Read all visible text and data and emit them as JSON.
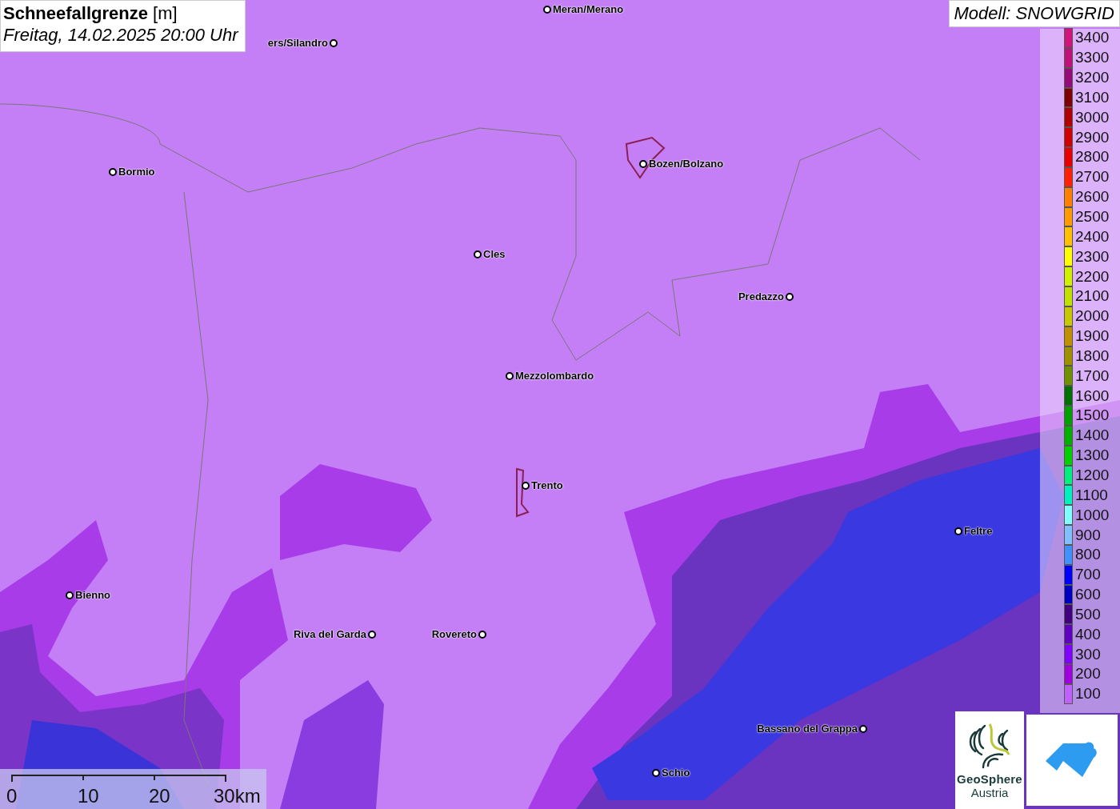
{
  "title": {
    "heading": "**Schneefallgrenze** [m]",
    "datetime": "Freitag, 14.02.2025 20:00 Uhr"
  },
  "model": "Modell: SNOWGRID",
  "cities": [
    {
      "name": "Meran/Merano"
    },
    {
      "name": "ers/Silandro"
    },
    {
      "name": "Bormio"
    },
    {
      "name": "Bozen/Bolzano"
    },
    {
      "name": "Cles"
    },
    {
      "name": "Predazzo"
    },
    {
      "name": "Mezzolombardo"
    },
    {
      "name": "Trento"
    },
    {
      "name": "Feltre"
    },
    {
      "name": "Bienno"
    },
    {
      "name": "Riva del Garda"
    },
    {
      "name": "Rovereto"
    },
    {
      "name": "Bassano del Grappa"
    },
    {
      "name": "Schio"
    }
  ],
  "legend": [
    {
      "label": "3400",
      "color": "#d0147c"
    },
    {
      "label": "3300",
      "color": "#c0107a"
    },
    {
      "label": "3200",
      "color": "#960a7a"
    },
    {
      "label": "3100",
      "color": "#800000"
    },
    {
      "label": "3000",
      "color": "#b00000"
    },
    {
      "label": "2900",
      "color": "#d00000"
    },
    {
      "label": "2800",
      "color": "#e80000"
    },
    {
      "label": "2700",
      "color": "#ff2000"
    },
    {
      "label": "2600",
      "color": "#ff8000"
    },
    {
      "label": "2500",
      "color": "#ff9a00"
    },
    {
      "label": "2400",
      "color": "#ffc000"
    },
    {
      "label": "2300",
      "color": "#ffff00"
    },
    {
      "label": "2200",
      "color": "#d0f000"
    },
    {
      "label": "2100",
      "color": "#c0e000"
    },
    {
      "label": "2000",
      "color": "#c8c800"
    },
    {
      "label": "1900",
      "color": "#c09000"
    },
    {
      "label": "1800",
      "color": "#a09000"
    },
    {
      "label": "1700",
      "color": "#709000"
    },
    {
      "label": "1600",
      "color": "#007000"
    },
    {
      "label": "1500",
      "color": "#00a000"
    },
    {
      "label": "1400",
      "color": "#00b000"
    },
    {
      "label": "1300",
      "color": "#00d000"
    },
    {
      "label": "1200",
      "color": "#00f080"
    },
    {
      "label": "1100",
      "color": "#00f0c0"
    },
    {
      "label": "1000",
      "color": "#80ffff"
    },
    {
      "label": "900",
      "color": "#80c0ff"
    },
    {
      "label": "800",
      "color": "#4090ff"
    },
    {
      "label": "700",
      "color": "#0000ff"
    },
    {
      "label": "600",
      "color": "#0000c0"
    },
    {
      "label": "500",
      "color": "#400080"
    },
    {
      "label": "400",
      "color": "#6000c0"
    },
    {
      "label": "300",
      "color": "#8000ff"
    },
    {
      "label": "200",
      "color": "#a000e0"
    },
    {
      "label": "100",
      "color": "#c060ff"
    }
  ],
  "scale": [
    "0",
    "10",
    "20",
    "30km"
  ],
  "logo": {
    "line1": "GeoSphere",
    "line2": "Austria"
  }
}
